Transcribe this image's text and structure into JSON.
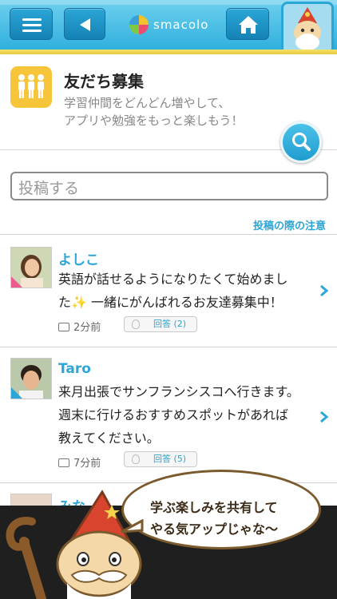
{
  "app": {
    "logo_text": "smacolo"
  },
  "header": {
    "title": "友だち募集",
    "desc_line1": "学習仲間をどんどん増やして、",
    "desc_line2": "アプリや勉強をもっと楽しもう！"
  },
  "compose": {
    "placeholder": "投稿する"
  },
  "note_link": "投稿の際の注意",
  "posts": [
    {
      "name": "よしこ",
      "line1": "英語が話せるようになりたくて始めまし",
      "line2": "た✨ 一緒にがんばれるお友達募集中！",
      "time": "2分前",
      "reply": "回答 (2)"
    },
    {
      "name": "Taro",
      "line1": "来月出張でサンフランシスコへ行きます。",
      "line2": "週末に行けるおすすめスポットがあれば",
      "line3": "教えてください。",
      "time": "7分前",
      "reply": "回答 (5)"
    },
    {
      "name": "みな"
    }
  ],
  "mascot": {
    "line1": "学ぶ楽しみを共有して",
    "line2": "やる気アップじゃな〜"
  },
  "colors": {
    "accent": "#2ba6d6",
    "topbar": "#3ab7e2",
    "header_icon": "#f6c53a"
  }
}
